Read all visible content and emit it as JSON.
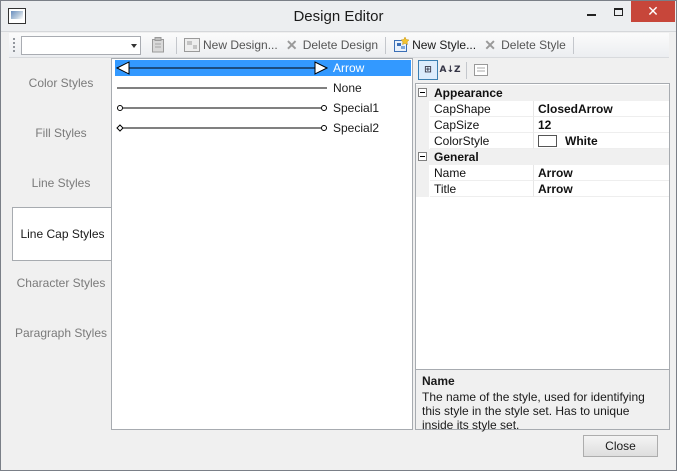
{
  "window": {
    "title": "Design Editor",
    "close_glyph": "✕"
  },
  "toolbar": {
    "design_combo_value": "",
    "new_design_label": "New Design...",
    "delete_design_label": "Delete Design",
    "new_style_label": "New Style...",
    "delete_style_label": "Delete Style"
  },
  "tabs": [
    {
      "label": "Color Styles",
      "active": false
    },
    {
      "label": "Fill Styles",
      "active": false
    },
    {
      "label": "Line Styles",
      "active": false
    },
    {
      "label": "Line Cap Styles",
      "active": true
    },
    {
      "label": "Character Styles",
      "active": false
    },
    {
      "label": "Paragraph Styles",
      "active": false
    }
  ],
  "styles": [
    {
      "label": "Arrow",
      "cap": "arrow",
      "selected": true
    },
    {
      "label": "None",
      "cap": "none",
      "selected": false
    },
    {
      "label": "Special1",
      "cap": "circle",
      "selected": false
    },
    {
      "label": "Special2",
      "cap": "diamond-circle",
      "selected": false
    }
  ],
  "property_grid": {
    "sort_categorized_label": "⊞",
    "sort_alpha_label": "A↓Z",
    "categories": [
      {
        "name": "Appearance",
        "properties": [
          {
            "name": "CapShape",
            "value": "ClosedArrow"
          },
          {
            "name": "CapSize",
            "value": "12"
          },
          {
            "name": "ColorStyle",
            "value": "White"
          }
        ]
      },
      {
        "name": "General",
        "properties": [
          {
            "name": "Name",
            "value": "Arrow"
          },
          {
            "name": "Title",
            "value": "Arrow"
          }
        ]
      }
    ],
    "help_title": "Name",
    "help_text": "The name of the style, used for identifying this style in the style set. Has to unique inside its style set."
  },
  "footer": {
    "close_label": "Close"
  },
  "colors": {
    "selection": "#3399ff",
    "window_bg": "#f0f0f0",
    "title_close": "#c7463a"
  }
}
